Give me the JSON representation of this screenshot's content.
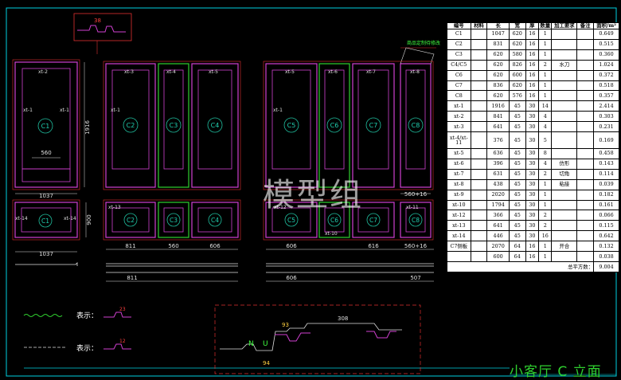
{
  "drawing": {
    "title": "小客厅 C 立面",
    "watermark": "模型组",
    "top_note": "商品定制待修改",
    "legend_label_1": "表示：",
    "legend_label_2": "表示："
  },
  "panel_tags": [
    "C1",
    "C2",
    "C3",
    "C4",
    "C5",
    "C6",
    "C7",
    "C8"
  ],
  "small_tags": [
    "C1",
    "C2",
    "C3",
    "C4",
    "C5",
    "C6",
    "C7",
    "C8"
  ],
  "dims": {
    "d1037a": "1037",
    "d1037b": "1037",
    "d900": "900",
    "d560a": "560",
    "d560b": "560",
    "d811a": "811",
    "d811b": "811",
    "d606a": "606",
    "d606b": "606",
    "d616": "616",
    "d560_16a": "560+16",
    "d560_16b": "560+16",
    "d1916": "1916",
    "d507": "507",
    "d308": "308",
    "d93": "93",
    "d94": "94",
    "d23": "23",
    "d12": "12"
  },
  "part_labels": [
    "xt-1",
    "xt-2",
    "xt-3",
    "xt-4",
    "xt-5",
    "xt-6",
    "xt-7",
    "xt-8",
    "xt-9",
    "xt-10",
    "xt-11",
    "xt-12",
    "xt-13",
    "xt-14"
  ],
  "table": {
    "headers": [
      "编号",
      "材料",
      "长",
      "宽",
      "厚",
      "数量",
      "加工要求",
      "备注",
      "面积/m²"
    ],
    "rows": [
      [
        "C1",
        "",
        "1047",
        "620",
        "16",
        "1",
        "",
        "",
        "0.649"
      ],
      [
        "C2",
        "",
        "831",
        "620",
        "16",
        "1",
        "",
        "",
        "0.515"
      ],
      [
        "C3",
        "",
        "620",
        "580",
        "16",
        "1",
        "",
        "",
        "0.360"
      ],
      [
        "C4/C5",
        "",
        "620",
        "826",
        "16",
        "2",
        "水刀",
        "",
        "1.024"
      ],
      [
        "C6",
        "",
        "620",
        "600",
        "16",
        "1",
        "",
        "",
        "0.372"
      ],
      [
        "C7",
        "",
        "836",
        "620",
        "16",
        "1",
        "",
        "",
        "0.518"
      ],
      [
        "C8",
        "",
        "620",
        "576",
        "16",
        "1",
        "",
        "",
        "0.357"
      ],
      [
        "xt-1",
        "",
        "1916",
        "45",
        "30",
        "14",
        "",
        "",
        "2.414"
      ],
      [
        "xt-2",
        "",
        "841",
        "45",
        "30",
        "4",
        "",
        "",
        "0.303"
      ],
      [
        "xt-3",
        "",
        "641",
        "45",
        "30",
        "4",
        "",
        "",
        "0.231"
      ],
      [
        "xt-4/xt-11",
        "",
        "376",
        "45",
        "30",
        "5",
        "",
        "",
        "0.169"
      ],
      [
        "xt-5",
        "",
        "636",
        "45",
        "30",
        "8",
        "",
        "",
        "0.458"
      ],
      [
        "xt-6",
        "",
        "396",
        "45",
        "30",
        "4",
        "",
        "",
        "0.143"
      ],
      [
        "xt-7",
        "",
        "631",
        "45",
        "30",
        "2",
        "",
        "",
        "0.114"
      ],
      [
        "xt-8",
        "",
        "438",
        "45",
        "30",
        "1",
        "",
        "",
        "0.039"
      ],
      [
        "xt-9",
        "",
        "2020",
        "45",
        "30",
        "1",
        "",
        "",
        "0.182"
      ],
      [
        "xt-10",
        "",
        "1794",
        "45",
        "30",
        "1",
        "",
        "",
        "0.161"
      ],
      [
        "xt-12",
        "",
        "366",
        "45",
        "30",
        "2",
        "",
        "",
        "0.066"
      ],
      [
        "xt-13",
        "",
        "641",
        "45",
        "30",
        "2",
        "",
        "",
        "0.115"
      ],
      [
        "xt-14",
        "",
        "446",
        "45",
        "30",
        "16",
        "",
        "",
        "0.642"
      ],
      [
        "C7侧板",
        "",
        "2070",
        "64",
        "16",
        "1",
        "开合",
        "",
        "0.132"
      ],
      [
        "",
        "",
        "600",
        "64",
        "16",
        "1",
        "",
        "",
        "0.038"
      ]
    ],
    "process_note": "仿形 切角 粘接",
    "total_label": "总平方数：",
    "total_value": "9.004"
  }
}
